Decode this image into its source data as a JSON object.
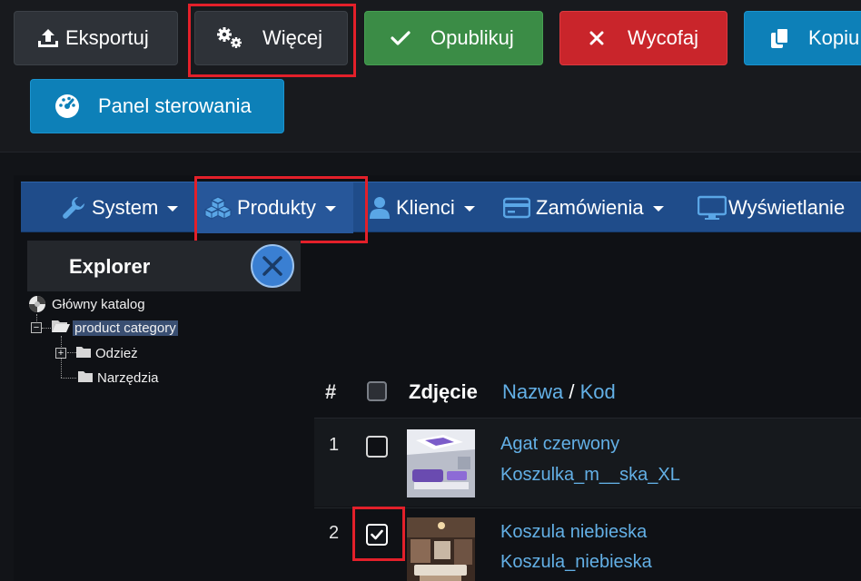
{
  "toolbar": {
    "export_label": "Eksportuj",
    "more_label": "Więcej",
    "publish_label": "Opublikuj",
    "unpublish_label": "Wycofaj",
    "copy_label": "Kopiu",
    "dashboard_label": "Panel sterowania"
  },
  "menu": {
    "items": [
      {
        "label": "System",
        "icon": "wrench-icon"
      },
      {
        "label": "Produkty",
        "icon": "cubes-icon"
      },
      {
        "label": "Klienci",
        "icon": "user-icon"
      },
      {
        "label": "Zamówienia",
        "icon": "credit-card-icon"
      },
      {
        "label": "Wyświetlanie",
        "icon": "monitor-icon"
      }
    ]
  },
  "explorer": {
    "title": "Explorer",
    "tree": {
      "root": "Główny katalog",
      "category": "product category",
      "children": [
        "Odzież",
        "Narzędzia"
      ]
    }
  },
  "table": {
    "headers": {
      "number": "#",
      "photo": "Zdjęcie",
      "name": "Nazwa",
      "separator": "/",
      "code": "Kod"
    },
    "rows": [
      {
        "index": "1",
        "name": "Agat czerwony",
        "code": "Koszulka_m__ska_XL",
        "checked": false
      },
      {
        "index": "2",
        "name": "Koszula niebieska",
        "code": "Koszula_niebieska",
        "checked": true
      }
    ]
  },
  "colors": {
    "highlight": "#e3202a",
    "navbar": "#1f4c8a",
    "link": "#63b0e6",
    "publish": "#3b8c46",
    "unpublish": "#c9252b",
    "info": "#0d80b8"
  }
}
